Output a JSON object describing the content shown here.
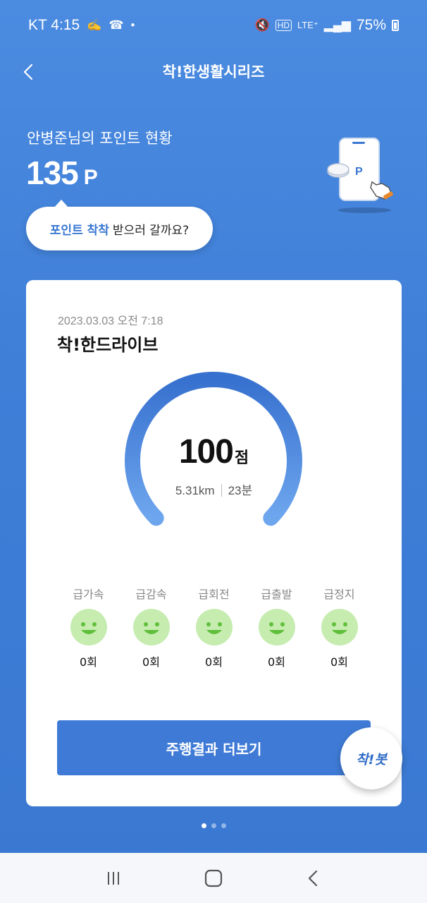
{
  "status_bar": {
    "carrier_time": "KT 4:15",
    "dot": "•",
    "battery": "75%",
    "icons": [
      "notification-icon",
      "wifi-calling-icon",
      "mute-icon",
      "hd-icon",
      "lte-icon",
      "signal-icon",
      "battery-icon"
    ]
  },
  "header": {
    "title": "착!한생활시리즈"
  },
  "points": {
    "label": "안병준님의 포인트 현황",
    "value": "135",
    "unit": "P",
    "illustration_letter": "P"
  },
  "bubble": {
    "highlight": "포인트 착착",
    "text": "받으러 갈까요?"
  },
  "card": {
    "date": "2023.03.03 오전 7:18",
    "title": "착!한드라이브",
    "score": "100",
    "score_unit": "점",
    "distance": "5.31km",
    "duration": "23분",
    "gauge_score_fraction": 1.0,
    "events": [
      {
        "label": "급가속",
        "count": "0회"
      },
      {
        "label": "급감속",
        "count": "0회"
      },
      {
        "label": "급회전",
        "count": "0회"
      },
      {
        "label": "급출발",
        "count": "0회"
      },
      {
        "label": "급정지",
        "count": "0회"
      }
    ],
    "more_button": "주행결과 더보기"
  },
  "fab": {
    "label": "착!봇"
  },
  "pager": {
    "total": 3,
    "active": 1
  },
  "colors": {
    "background": "#3f7fd8",
    "accent": "#3f7bd6",
    "smile_face": "#c6ecb0",
    "smile_feature": "#5fbf3a"
  }
}
